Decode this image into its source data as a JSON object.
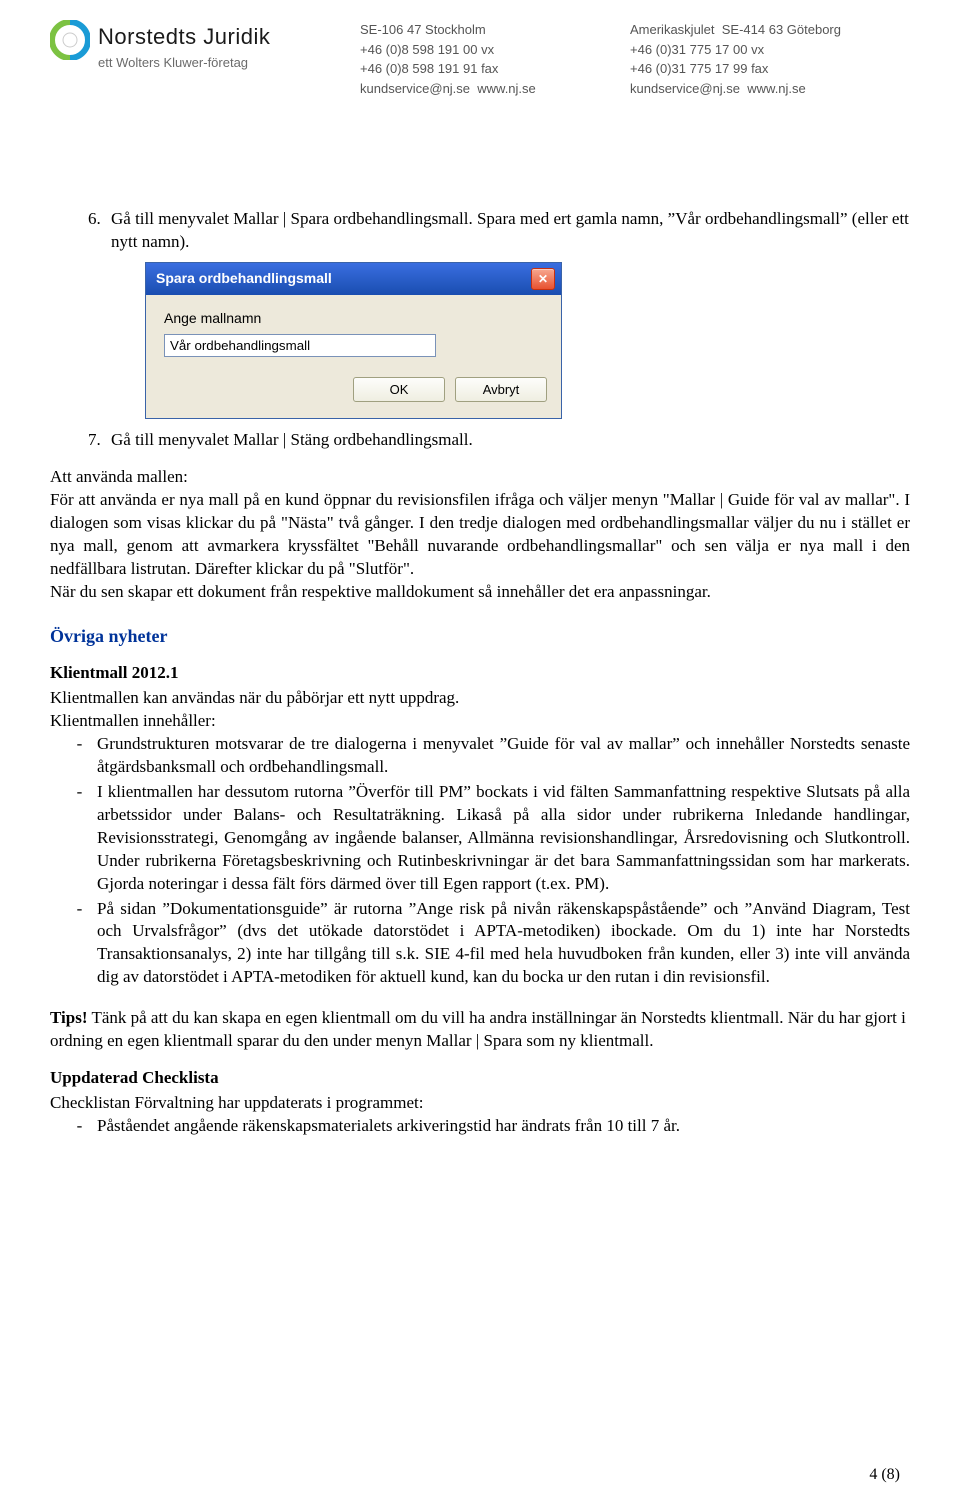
{
  "header": {
    "brand": "Norstedts Juridik",
    "subbrand": "ett Wolters Kluwer-företag",
    "col1": {
      "l1": "SE-106 47 Stockholm",
      "l2": "+46 (0)8 598 191 00 vx",
      "l3": "+46 (0)8 598 191 91 fax",
      "l4": "kundservice@nj.se  www.nj.se"
    },
    "col2": {
      "l1": "Amerikaskjulet  SE-414 63 Göteborg",
      "l2": "+46 (0)31 775 17 00 vx",
      "l3": "+46 (0)31 775 17 99 fax",
      "l4": "kundservice@nj.se  www.nj.se"
    }
  },
  "step6": "Gå till menyvalet Mallar | Spara ordbehandlingsmall. Spara med ert gamla namn, ”Vår ordbehandlingsmall” (eller ett nytt namn).",
  "dialog": {
    "title": "Spara ordbehandlingsmall",
    "label": "Ange mallnamn",
    "value": "Vår ordbehandlingsmall",
    "ok": "OK",
    "cancel": "Avbryt"
  },
  "step7": "Gå till menyvalet Mallar | Stäng ordbehandlingsmall.",
  "use_mall": "Att använda mallen:\nFör att använda er nya mall på en kund öppnar du revisionsfilen ifråga och väljer menyn \"Mallar | Guide för val av mallar\". I dialogen som visas klickar du på \"Nästa\" två gånger. I den tredje dialogen med ordbehandlingsmallar väljer du nu i stället er nya mall, genom att avmarkera kryssfältet \"Behåll nuvarande ordbehandlingsmallar\" och sen välja er nya mall i den nedfällbara listrutan. Därefter klickar du på \"Slutför\".\nNär du sen skapar ett dokument från respektive malldokument så innehåller det era anpassningar.",
  "h_news": "Övriga nyheter",
  "h_klient": "Klientmall 2012.1",
  "klient_intro": "Klientmallen kan användas när du påbörjar ett nytt uppdrag.\nKlientmallen innehåller:",
  "klient_b1": "Grundstrukturen motsvarar de tre dialogerna i menyvalet ”Guide för val av mallar” och innehåller Norstedts senaste åtgärdsbanksmall och ordbehandlingsmall.",
  "klient_b2": "I klientmallen har dessutom rutorna ”Överför till PM” bockats i vid fälten Sammanfattning respektive Slutsats på alla arbetssidor under Balans- och Resultaträkning. Likaså på alla sidor under rubrikerna Inledande handlingar, Revisionsstrategi, Genomgång av ingående balanser, Allmänna revisionshandlingar, Årsredovisning och Slutkontroll. Under rubrikerna Företagsbeskrivning och Rutinbeskrivningar är det bara Sammanfattningssidan som har markerats. Gjorda noteringar i dessa fält förs därmed över till Egen rapport (t.ex. PM).",
  "klient_b3": "På sidan ”Dokumentationsguide” är rutorna ”Ange risk på nivån räkenskapspåstående” och ”Använd Diagram, Test och Urvalsfrågor” (dvs det utökade datorstödet i APTA-metodiken) ibockade. Om du 1) inte har Norstedts Transaktionsanalys, 2) inte har tillgång till s.k. SIE 4-fil med hela huvudboken från kunden, eller 3) inte vill använda dig av datorstödet i APTA-metodiken för aktuell kund, kan du bocka ur den rutan i din revisionsfil.",
  "tips_label": "Tips!",
  "tips_body": " Tänk på att du kan skapa en egen klientmall om du vill ha andra inställningar än Norstedts klientmall. När du har gjort i ordning en egen klientmall sparar du den under menyn Mallar | Spara som ny klientmall.",
  "h_check": "Uppdaterad Checklista",
  "check_intro": "Checklistan Förvaltning har uppdaterats i programmet:",
  "check_b1": "Påståendet angående räkenskapsmaterialets arkiveringstid har ändrats från 10 till 7 år.",
  "pagenum": "4 (8)"
}
